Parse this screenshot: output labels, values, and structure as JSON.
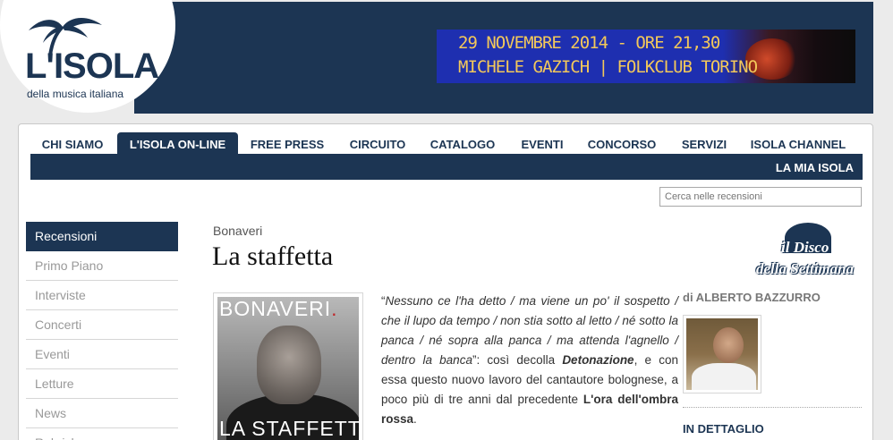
{
  "logo": {
    "title": "L'ISOLA",
    "subtitle": "della musica italiana"
  },
  "banner": {
    "line1": "29 NOVEMBRE 2014 - ORE 21,30",
    "line2": "MICHELE GAZICH | FOLKCLUB TORINO"
  },
  "nav": {
    "items": [
      {
        "label": "CHI SIAMO"
      },
      {
        "label": "L'ISOLA ON-LINE"
      },
      {
        "label": "FREE PRESS"
      },
      {
        "label": "CIRCUITO"
      },
      {
        "label": "CATALOGO"
      },
      {
        "label": "EVENTI"
      },
      {
        "label": "CONCORSO"
      },
      {
        "label": "SERVIZI"
      },
      {
        "label": "ISOLA CHANNEL"
      }
    ],
    "active": "L'ISOLA ON-LINE",
    "sub_item": "LA MIA ISOLA"
  },
  "search": {
    "placeholder": "Cerca nelle recensioni"
  },
  "sidebar": {
    "items": [
      {
        "label": "Recensioni"
      },
      {
        "label": "Primo Piano"
      },
      {
        "label": "Interviste"
      },
      {
        "label": "Concerti"
      },
      {
        "label": "Eventi"
      },
      {
        "label": "Letture"
      },
      {
        "label": "News"
      },
      {
        "label": "Rubriche"
      }
    ],
    "active": "Recensioni"
  },
  "article": {
    "artist": "Bonaveri",
    "title": "La staffetta",
    "cover": {
      "band_main": "BONAVERI",
      "band_dot": ".",
      "album": "LA STAFFETTA"
    },
    "body": {
      "quote_open": "“",
      "quote": "Nessuno ce l'ha detto / ma viene un po' il sospetto / che il lupo da tempo / non stia sotto al letto / né sotto la panca / né sopra alla panca / ma attenda l'agnello / dentro la banca",
      "quote_close": "”: così decolla ",
      "song": "Detonazione",
      "text1": ", e con essa questo nuovo lavoro del cantautore bolognese, a poco più di tre anni dal precedente ",
      "prev_album": "L'ora dell'ombra rossa",
      "text2": "."
    }
  },
  "right": {
    "badge_line1": "il Disco",
    "badge_line2": "della Settimana",
    "author": "di ALBERTO BAZZURRO",
    "detail": "IN DETTAGLIO"
  },
  "colors": {
    "brand": "#1c3553",
    "banner": "#1e2fb0",
    "banner_text": "#f3c85a"
  }
}
